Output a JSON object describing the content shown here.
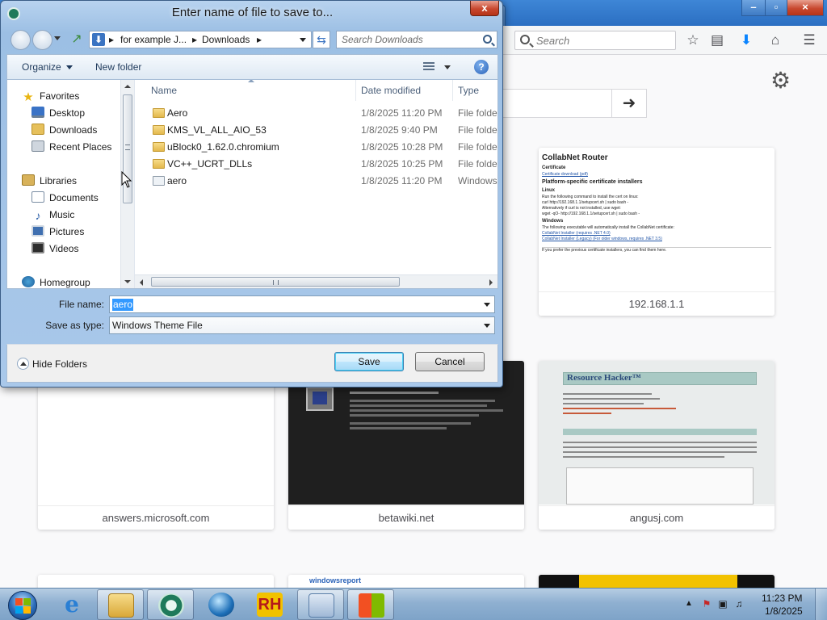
{
  "dialog": {
    "title": "Enter name of file to save to...",
    "close_glyph": "x",
    "address": {
      "segments": [
        "for example J...",
        "Downloads"
      ],
      "separator": "▸"
    },
    "search_placeholder": "Search Downloads",
    "toolbar": {
      "organize": "Organize",
      "new_folder": "New folder",
      "help": "?"
    },
    "nav_pane": {
      "favorites_label": "Favorites",
      "favorites": [
        "Desktop",
        "Downloads",
        "Recent Places"
      ],
      "libraries_label": "Libraries",
      "libraries": [
        "Documents",
        "Music",
        "Pictures",
        "Videos"
      ],
      "homegroup_label": "Homegroup"
    },
    "columns": {
      "name": "Name",
      "date": "Date modified",
      "type": "Type"
    },
    "files": [
      {
        "name": "Aero",
        "date": "1/8/2025 11:20 PM",
        "type": "File folder",
        "icon": "folder-icon"
      },
      {
        "name": "KMS_VL_ALL_AIO_53",
        "date": "1/8/2025 9:40 PM",
        "type": "File folder",
        "icon": "folder-icon"
      },
      {
        "name": "uBlock0_1.62.0.chromium",
        "date": "1/8/2025 10:28 PM",
        "type": "File folder",
        "icon": "folder-icon"
      },
      {
        "name": "VC++_UCRT_DLLs",
        "date": "1/8/2025 10:25 PM",
        "type": "File folder",
        "icon": "folder-icon"
      },
      {
        "name": "aero",
        "date": "1/8/2025 11:20 PM",
        "type": "Windows",
        "icon": "theme-file-icon"
      }
    ],
    "file_name_label": "File name:",
    "file_name_value": "aero",
    "save_type_label": "Save as type:",
    "save_type_value": "Windows Theme File",
    "hide_folders": "Hide Folders",
    "save_button": "Save",
    "cancel_button": "Cancel"
  },
  "browser": {
    "search_placeholder": "Search",
    "go_arrow": "➜",
    "tiles": [
      {
        "caption": "192.168.1.1",
        "thumb": {
          "title": "CollabNet Router",
          "certificate": "Certificate",
          "cert_link": "Certificate download (pdf)",
          "installers": "Platform-specific certificate installers",
          "linux": "Linux",
          "linux_text": "Run the following command to install the cert on linux:",
          "cmd1": "curl http://192.168.1.1/setupcert.sh | sudo bash -",
          "alt_text": "Alternatively if curl is not installed, use wget:",
          "cmd2": "wget -qO- http://192.168.1.1/setupcert.sh | sudo bash -",
          "windows": "Windows",
          "windows_text": "The following executable will automatically install the CollabNet certificate:",
          "link1": "CollabNet Installer (requires .NET 4.0)",
          "link2": "CollabNet Installer (Legacy) (For older windows, requires .NET 3.5)",
          "footer": "If you prefer the previous certificate installers, you can find them here."
        }
      },
      {
        "caption": "answers.microsoft.com"
      },
      {
        "caption": "betawiki.net"
      },
      {
        "caption": "angusj.com",
        "thumb": {
          "title": "Resource Hacker™"
        }
      }
    ],
    "bottom_tiles": [
      "windowsreport"
    ]
  },
  "taskbar": {
    "apps": [
      {
        "name": "internet-explorer",
        "glyph": "e"
      },
      {
        "name": "file-explorer",
        "glyph": ""
      },
      {
        "name": "app-circle",
        "glyph": ""
      },
      {
        "name": "globe-app",
        "glyph": ""
      },
      {
        "name": "resource-hacker",
        "glyph": "RH"
      },
      {
        "name": "control-panel",
        "glyph": ""
      },
      {
        "name": "windows-flag",
        "glyph": ""
      }
    ],
    "clock_time": "11:23 PM",
    "clock_date": "1/8/2025"
  },
  "colors": {
    "dialog_frame": "#a9c8ea",
    "selection": "#3399ff",
    "titlebar": "#2b6fc2"
  }
}
